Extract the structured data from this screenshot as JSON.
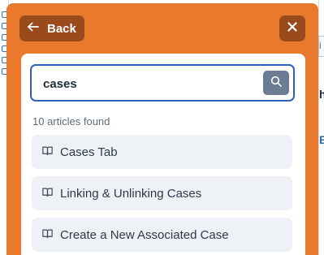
{
  "header": {
    "back_label": "Back",
    "back_icon": "arrow-left-icon",
    "close_icon": "close-icon"
  },
  "search": {
    "value": "cases",
    "placeholder": "",
    "button_icon": "search-icon"
  },
  "results": {
    "count_text": "10 articles found",
    "items": [
      {
        "label": "Cases Tab",
        "icon": "book-icon"
      },
      {
        "label": "Linking & Unlinking Cases",
        "icon": "book-icon"
      },
      {
        "label": "Create a New Associated Case",
        "icon": "book-icon"
      }
    ]
  },
  "background": {
    "right_chars": [
      "i",
      "h",
      "E"
    ]
  },
  "colors": {
    "panel": "#e8792d",
    "panel_button": "#9b4a1e",
    "search_border": "#2f5fbf",
    "search_button": "#6b7c93",
    "result_bg": "#eef1f5"
  }
}
